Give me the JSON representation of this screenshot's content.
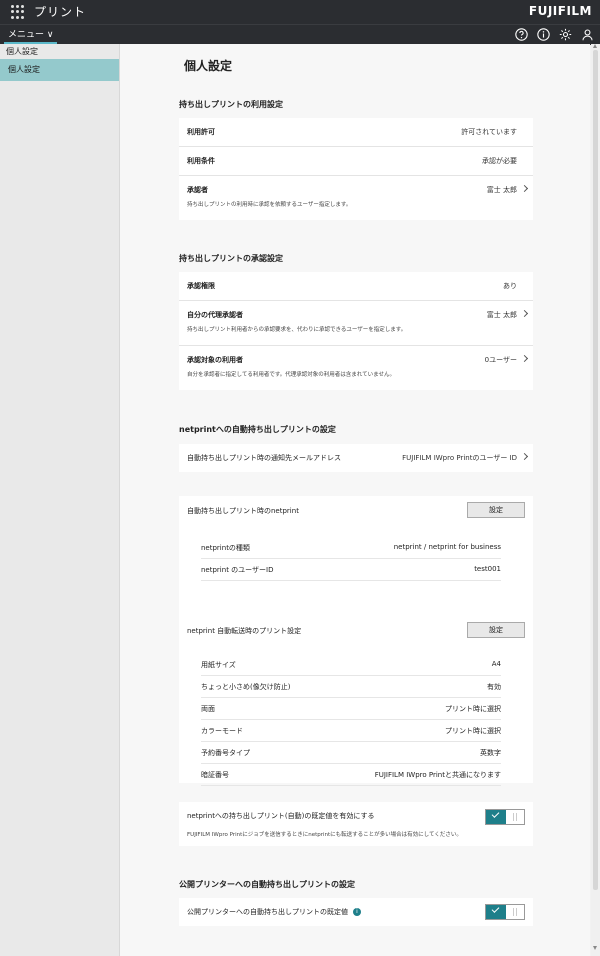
{
  "header": {
    "app_title": "プリント",
    "brand": "FUJIFILM",
    "menu_label": "メニュー"
  },
  "sidebar": {
    "group": "個人設定",
    "items": [
      {
        "label": "個人設定"
      }
    ]
  },
  "page": {
    "title": "個人設定"
  },
  "sections": {
    "usage": {
      "title": "持ち出しプリントの利用設定",
      "rows": [
        {
          "label": "利用許可",
          "value": "許可されています"
        },
        {
          "label": "利用条件",
          "value": "承認が必要"
        },
        {
          "label": "承認者",
          "value": "富士 太郎",
          "desc": "持ち出しプリントの利用時に承認を依頼するユーザー指定します。"
        }
      ]
    },
    "approval": {
      "title": "持ち出しプリントの承認設定",
      "rows": [
        {
          "label": "承認権限",
          "value": "あり"
        },
        {
          "label": "自分の代理承認者",
          "value": "富士 太郎",
          "desc": "持ち出しプリント利用者からの承認要求を、代わりに承認できるユーザーを指定します。"
        },
        {
          "label": "承認対象の利用者",
          "value": "0ユーザー",
          "desc": "自分を承認者に指定してる利用者です。代理承認対象の利用者は含まれていません。"
        }
      ]
    },
    "netprint": {
      "title": "netprintへの自動持ち出しプリントの設定",
      "mail_row": {
        "label": "自動持ち出しプリント時の通知先メールアドレス",
        "value": "FUJIFILM IWpro Printのユーザー ID"
      },
      "np_card": {
        "label": "自動持ち出しプリント時のnetprint",
        "button": "設定",
        "rows": [
          {
            "label": "netprintの種類",
            "value": "netprint / netprint for business"
          },
          {
            "label": "netprint のユーザーID",
            "value": "test001"
          }
        ]
      },
      "print_card": {
        "label": "netprint 自動転送時のプリント設定",
        "button": "設定",
        "rows": [
          {
            "label": "用紙サイズ",
            "value": "A4"
          },
          {
            "label": "ちょっと小さめ(像欠け防止)",
            "value": "有効"
          },
          {
            "label": "両面",
            "value": "プリント時に選択"
          },
          {
            "label": "カラーモード",
            "value": "プリント時に選択"
          },
          {
            "label": "予約番号タイプ",
            "value": "英数字"
          },
          {
            "label": "暗証番号",
            "value": "FUJIFILM IWpro Printと共通になります"
          }
        ]
      },
      "toggle_row": {
        "label": "netprintへの持ち出しプリント(自動)の既定値を有効にする",
        "desc": "FUJIFILM IWpro Printにジョブを送信するときにnetprintにも転送することが多い場合は有効にしてください。"
      }
    },
    "public": {
      "title": "公開プリンターへの自動持ち出しプリントの設定",
      "toggle_row": {
        "label": "公開プリンターへの自動持ち出しプリントの既定値"
      }
    }
  },
  "colors": {
    "accent": "#1e7f8a",
    "sidebar_active": "#94c9cc",
    "topbar": "#2b2d31"
  }
}
